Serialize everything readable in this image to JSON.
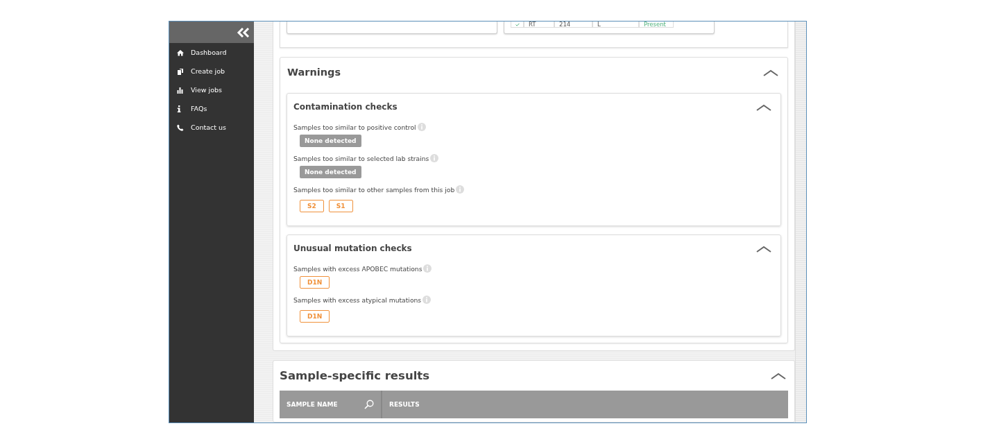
{
  "sidebar": {
    "items": [
      {
        "label": "Dashboard",
        "kind": "home"
      },
      {
        "label": "Create job",
        "kind": "document"
      },
      {
        "label": "View jobs",
        "kind": "chart"
      },
      {
        "label": "FAQs",
        "kind": "info"
      },
      {
        "label": "Contact us",
        "kind": "phone"
      }
    ]
  },
  "top_table_row": {
    "checked": true,
    "cells": [
      "RT",
      "214",
      "L"
    ],
    "status": "Present"
  },
  "warnings": {
    "title": "Warnings",
    "expanded": true,
    "groups": [
      {
        "title": "Contamination checks",
        "expanded": true,
        "checks": [
          {
            "label": "Samples too similar to positive control",
            "results": [
              {
                "text": "None detected",
                "kind": "none"
              }
            ]
          },
          {
            "label": "Samples too similar to selected lab strains",
            "results": [
              {
                "text": "None detected",
                "kind": "none"
              }
            ]
          },
          {
            "label": "Samples too similar to other samples from this job",
            "results": [
              {
                "text": "S2",
                "kind": "sample"
              },
              {
                "text": "S1",
                "kind": "sample"
              }
            ]
          }
        ]
      },
      {
        "title": "Unusual mutation checks",
        "expanded": true,
        "checks": [
          {
            "label": "Samples with excess APOBEC mutations",
            "results": [
              {
                "text": "D1N",
                "kind": "sample"
              }
            ]
          },
          {
            "label": "Samples with excess atypical mutations",
            "results": [
              {
                "text": "D1N",
                "kind": "sample"
              }
            ]
          }
        ]
      }
    ]
  },
  "sample_results": {
    "title": "Sample-specific results",
    "expanded": true,
    "columns": [
      "SAMPLE NAME",
      "RESULTS"
    ]
  }
}
